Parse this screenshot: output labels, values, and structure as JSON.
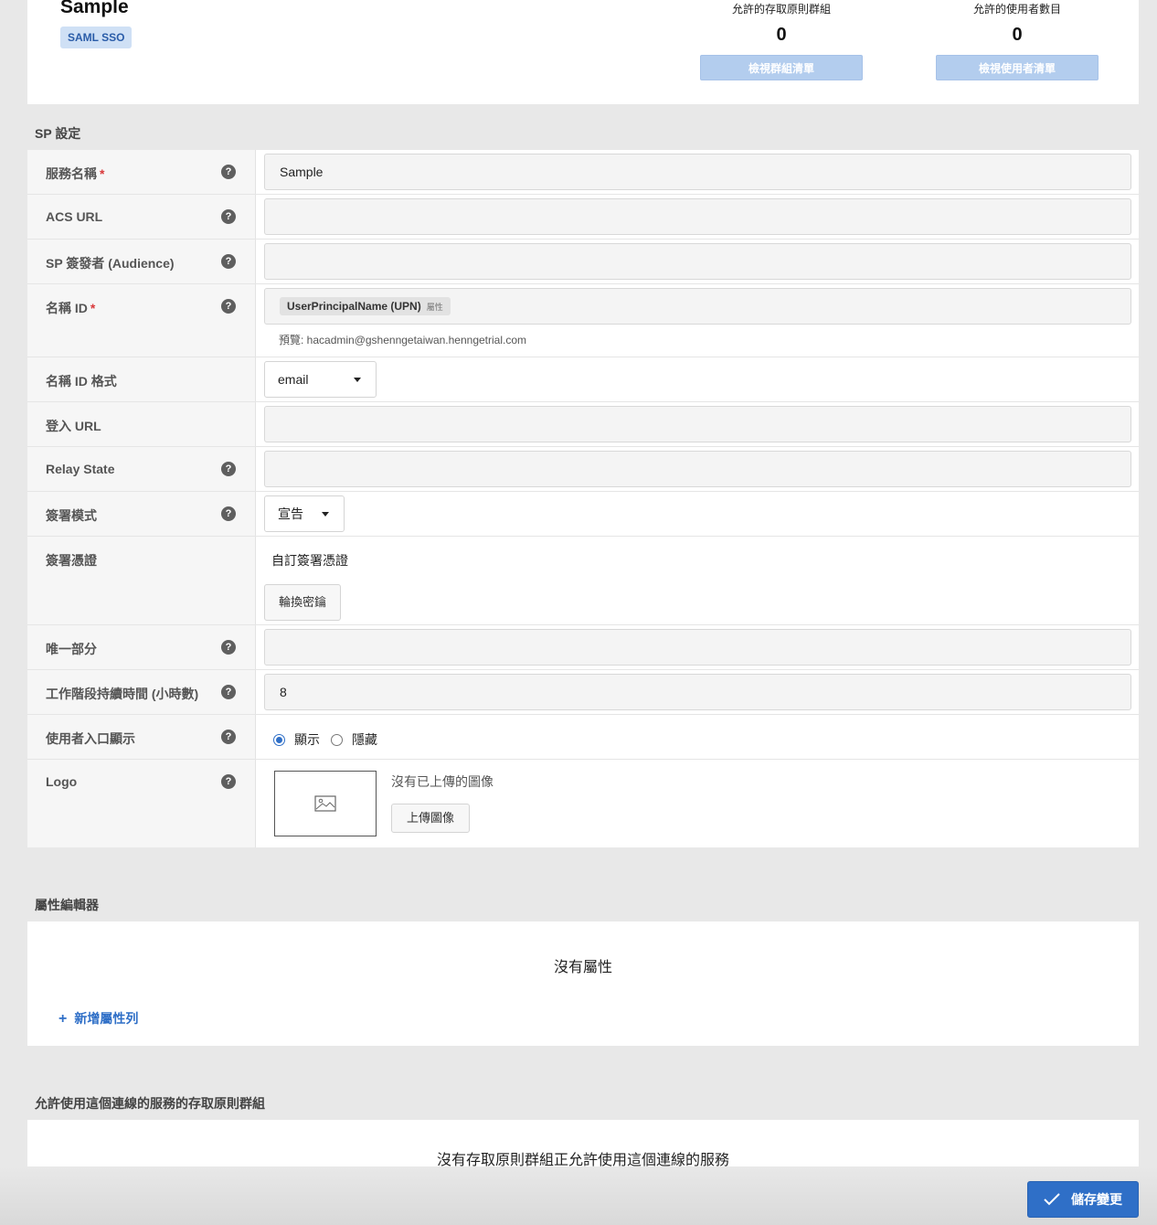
{
  "header": {
    "service_name": "Sample",
    "badge": "SAML SSO",
    "stats": [
      {
        "label": "允許的存取原則群組",
        "value": "0",
        "button": "檢視群組清單"
      },
      {
        "label": "允許的使用者數目",
        "value": "0",
        "button": "檢視使用者清單"
      }
    ]
  },
  "sp_section": {
    "title": "SP 設定",
    "service_name": {
      "label": "服務名稱",
      "required": "*",
      "value": "Sample"
    },
    "acs_url": {
      "label": "ACS URL",
      "value": ""
    },
    "sp_issuer": {
      "label": "SP 簽發者 (Audience)",
      "value": ""
    },
    "name_id": {
      "label": "名稱 ID",
      "required": "*",
      "chip": "UserPrincipalName (UPN)",
      "chip_tag": "屬性",
      "preview": "預覽:  hacadmin@gshenngetaiwan.henngetrial.com"
    },
    "name_id_format": {
      "label": "名稱 ID 格式",
      "value": "email"
    },
    "login_url": {
      "label": "登入 URL",
      "value": ""
    },
    "relay_state": {
      "label": "Relay State",
      "value": ""
    },
    "signing_mode": {
      "label": "簽署模式",
      "value": "宣告"
    },
    "signing_cert": {
      "label": "簽署憑證",
      "value": "自訂簽署憑證",
      "button": "輪換密鑰"
    },
    "unique_part": {
      "label": "唯一部分",
      "value": ""
    },
    "session_duration": {
      "label": "工作階段持續時間 (小時數)",
      "value": "8"
    },
    "portal_display": {
      "label": "使用者入口顯示",
      "options": [
        "顯示",
        "隱藏"
      ],
      "selected": "顯示"
    },
    "logo": {
      "label": "Logo",
      "empty_text": "沒有已上傳的圖像",
      "button": "上傳圖像"
    }
  },
  "attr_section": {
    "title": "屬性編輯器",
    "empty_text": "沒有屬性",
    "add_link": "新增屬性列"
  },
  "policy_section": {
    "title": "允許使用這個連線的服務的存取原則群組",
    "empty_text": "沒有存取原則群組正允許使用這個連線的服務"
  },
  "footer": {
    "save_button": "儲存變更"
  },
  "colors": {
    "accent": "#2f6fc7",
    "badge_bg": "#cfe0f5",
    "disabled_button": "#b3cdee",
    "required": "#d9383a"
  }
}
